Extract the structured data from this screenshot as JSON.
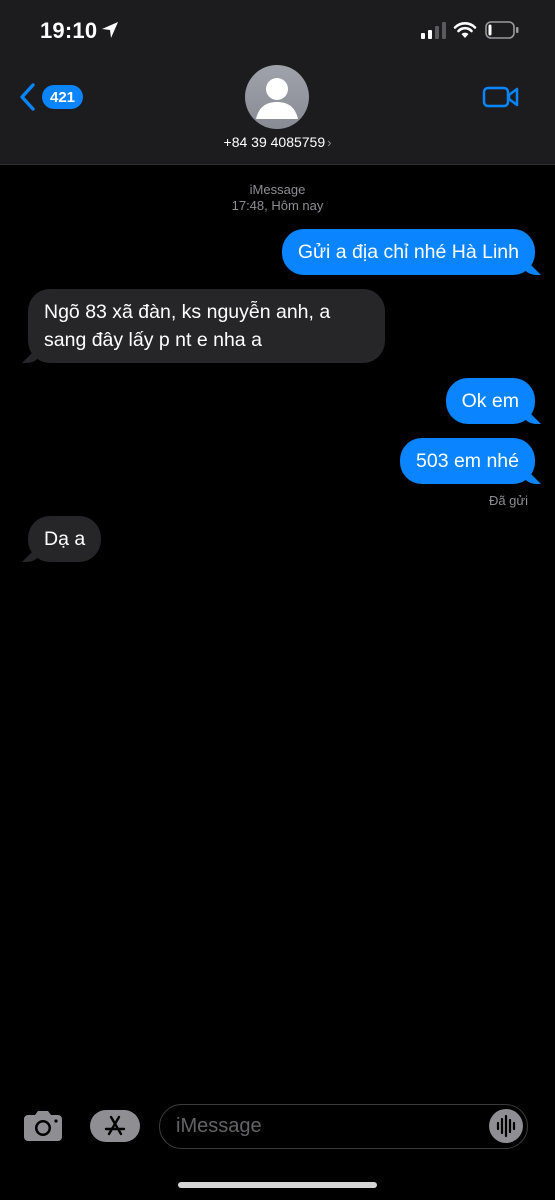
{
  "status_bar": {
    "time": "19:10",
    "icons": [
      "location-arrow-icon",
      "cellular-signal-icon",
      "wifi-icon",
      "battery-icon"
    ]
  },
  "header": {
    "back_count": "421",
    "contact": "+84 39 4085759",
    "contact_chevron": "›",
    "icons": [
      "chevron-left-icon",
      "person-avatar-icon",
      "video-camera-icon"
    ]
  },
  "conversation": {
    "service": "iMessage",
    "timestamp": "17:48, Hôm nay",
    "messages": [
      {
        "direction": "outgoing",
        "text": "Gửi a địa chỉ nhé Hà Linh"
      },
      {
        "direction": "incoming",
        "text": "Ngõ 83 xã đàn, ks nguyễn anh, a sang đây lấy p nt e nha a"
      },
      {
        "direction": "outgoing",
        "text": "Ok em"
      },
      {
        "direction": "outgoing",
        "text": "503 em nhé"
      },
      {
        "direction": "incoming",
        "text": "Dạ a"
      }
    ],
    "delivery_status": "Đã gửi"
  },
  "composer": {
    "placeholder": "iMessage",
    "icons": [
      "camera-icon",
      "app-store-icon",
      "audio-waveform-icon"
    ]
  },
  "colors": {
    "accent": "#0a84ff",
    "header_bg": "#1c1c1e",
    "incoming_bubble": "#262628",
    "background": "#000000"
  }
}
